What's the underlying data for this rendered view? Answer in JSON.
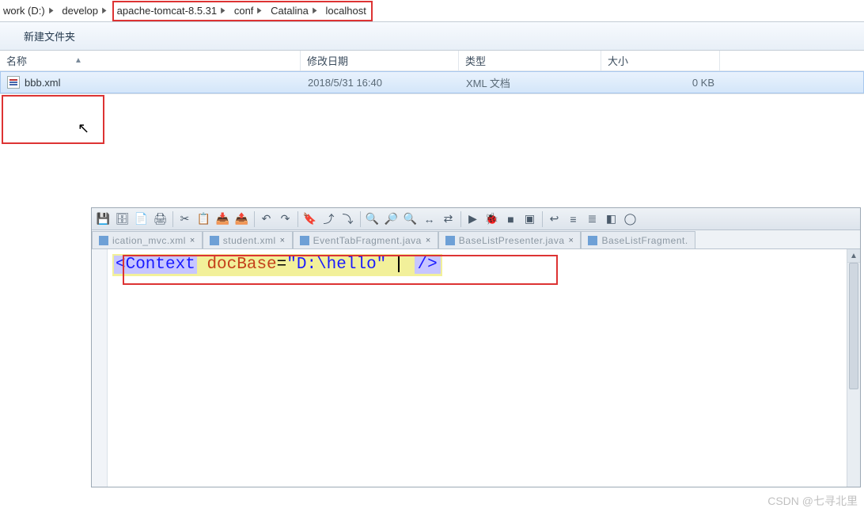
{
  "address_bar": {
    "crumbs": [
      {
        "label": "work (D:)"
      },
      {
        "label": "develop"
      },
      {
        "label": "apache-tomcat-8.5.31"
      },
      {
        "label": "conf"
      },
      {
        "label": "Catalina"
      },
      {
        "label": "localhost"
      }
    ]
  },
  "toolbar": {
    "new_folder": "新建文件夹"
  },
  "columns": {
    "name": "名称",
    "modified": "修改日期",
    "type": "类型",
    "size": "大小"
  },
  "files": [
    {
      "name": "bbb.xml",
      "modified": "2018/5/31 16:40",
      "type": "XML 文档",
      "size": "0 KB"
    }
  ],
  "editor": {
    "tabs": [
      {
        "label": "ication_mvc.xml"
      },
      {
        "label": "student.xml"
      },
      {
        "label": "EventTabFragment.java"
      },
      {
        "label": "BaseListPresenter.java"
      },
      {
        "label": "BaseListFragment."
      }
    ],
    "code": {
      "open_tag": "<Context",
      "attr": "docBase",
      "eq": "=",
      "value": "\"D:\\hello\"",
      "close": "/>"
    },
    "toolbar_icons": [
      "save",
      "save-all",
      "copy",
      "print",
      "cut",
      "copy2",
      "paste",
      "paste2",
      "undo",
      "redo",
      "|",
      "bookmark",
      "bookmark-prev",
      "bookmark-next",
      "|",
      "find",
      "find-next",
      "find-prev",
      "replace",
      "replace-all",
      "|",
      "run",
      "debug",
      "stop",
      "terminal",
      "|",
      "wrap",
      "format",
      "format2",
      "symbols"
    ]
  },
  "watermark": "CSDN @七寻北里"
}
